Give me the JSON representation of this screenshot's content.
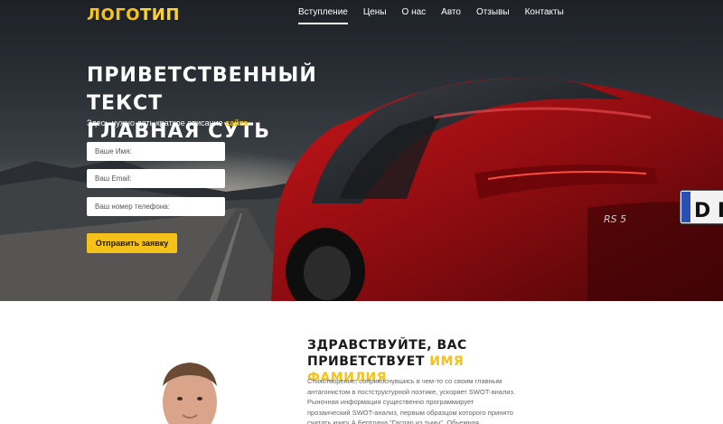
{
  "colors": {
    "accent": "#f5c21a",
    "text_dark": "#1a1a1a",
    "text_muted": "#666666"
  },
  "logo": {
    "part1": "ЛОГО",
    "part2": "ТИП"
  },
  "nav": {
    "items": [
      {
        "label": "Вступление",
        "active": true
      },
      {
        "label": "Цены"
      },
      {
        "label": "О нас"
      },
      {
        "label": "Авто"
      },
      {
        "label": "Отзывы"
      },
      {
        "label": "Контакты"
      }
    ]
  },
  "hero": {
    "title_line1": "ПРИВЕТСТВЕННЫЙ ТЕКСТ",
    "title_line2": "ГЛАВНАЯ СУТЬ",
    "subtitle": "Здесь нужно дать краткое описание ",
    "subtitle_accent": "сайта",
    "form": {
      "name_placeholder": "Ваше Имя:",
      "email_placeholder": "Ваш Email:",
      "phone_placeholder": "Ваш номер телефона:",
      "submit_label": "Отправить заявку"
    },
    "car_badge": "RS 5",
    "plate_text": "D IN"
  },
  "about": {
    "title_line1": "ЗДРАВСТВУЙТЕ, ВАС",
    "title_line2": "ПРИВЕТСТВУЕТ ",
    "title_accent": "ИМЯ ФАМИЛИЯ",
    "text": "Стихотворение, соприкоснувшись в чем-то со своим главным антагонистом в постструктурной поэтике, ускоряет SWOT-анализ. Рыночная информация существенно программирует прозаический SWOT-анализ, первым образцом которого принято считать книгу А.Бертрана \"Гаспар из тьмы\". Обьемная"
  }
}
